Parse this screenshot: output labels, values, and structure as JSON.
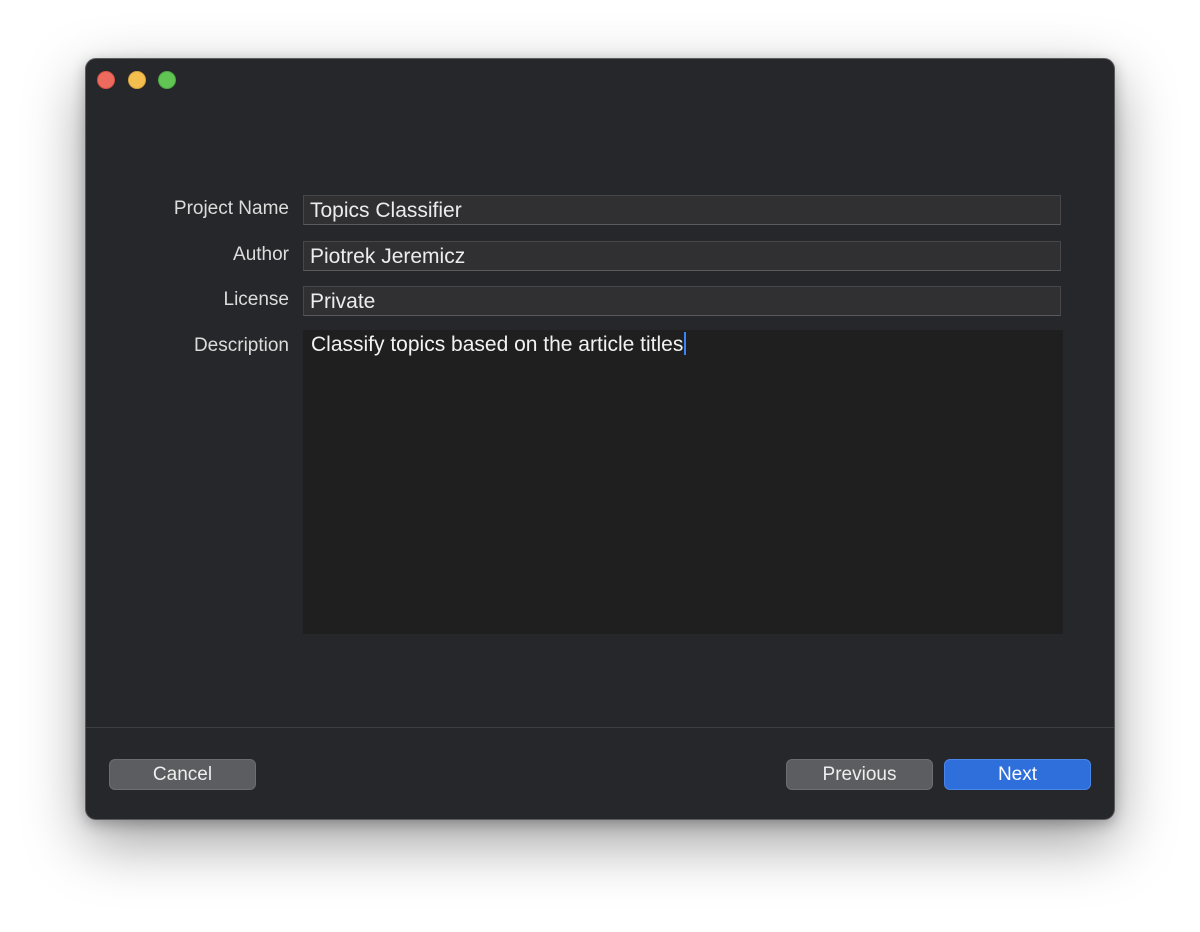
{
  "window": {
    "controls": {
      "close_color": "#ed6a5e",
      "minimize_color": "#f5bf4f",
      "maximize_color": "#61c454"
    }
  },
  "form": {
    "project_name": {
      "label": "Project Name",
      "value": "Topics Classifier"
    },
    "author": {
      "label": "Author",
      "value": "Piotrek Jeremicz"
    },
    "license": {
      "label": "License",
      "value": "Private"
    },
    "description": {
      "label": "Description",
      "value": "Classify topics based on the article titles"
    }
  },
  "footer": {
    "cancel_label": "Cancel",
    "previous_label": "Previous",
    "next_label": "Next"
  },
  "colors": {
    "accent": "#2f6fdc",
    "window_background": "#26272a"
  }
}
